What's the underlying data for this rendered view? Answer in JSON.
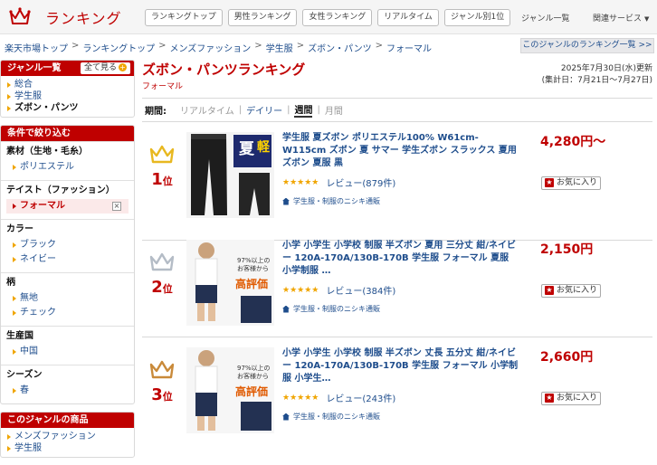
{
  "header": {
    "logo_text": "ランキング",
    "tabs": [
      "ランキングトップ",
      "男性ランキング",
      "女性ランキング",
      "リアルタイム",
      "ジャンル別1位"
    ],
    "genre_menu": "ジャンル一覧",
    "related_menu": "関連サービス"
  },
  "breadcrumb": [
    "楽天市場トップ",
    "ランキングトップ",
    "メンズファッション",
    "学生服",
    "ズボン・パンツ",
    "フォーマル"
  ],
  "genre_list_button": "このジャンルのランキング一覧 >>",
  "sidebar": {
    "genre_title": "ジャンル一覧",
    "show_all": "全て見る",
    "genres": [
      "総合",
      "学生服",
      "ズボン・パンツ"
    ],
    "filter_title": "条件で絞り込む",
    "filters": [
      {
        "title": "素材（生地・毛糸）",
        "options": [
          "ポリエステル"
        ]
      },
      {
        "title": "テイスト（ファッション）",
        "options": [
          "フォーマル"
        ],
        "selected": "フォーマル"
      },
      {
        "title": "カラー",
        "options": [
          "ブラック",
          "ネイビー"
        ]
      },
      {
        "title": "柄",
        "options": [
          "無地",
          "チェック"
        ]
      },
      {
        "title": "生産国",
        "options": [
          "中国"
        ]
      },
      {
        "title": "シーズン",
        "options": [
          "春"
        ]
      }
    ],
    "genre_products_title": "このジャンルの商品",
    "genre_products": [
      "メンズファッション",
      "学生服"
    ]
  },
  "main": {
    "title": "ズボン・パンツランキング",
    "subtitle": "フォーマル",
    "updated": "2025年7月30日(水)更新",
    "period_range": "(集計日：7月21日〜7月27日)",
    "period_label": "期間:",
    "periods": [
      "リアルタイム",
      "デイリー",
      "週間",
      "月間"
    ],
    "current_period": "週間"
  },
  "items": [
    {
      "rank": "1",
      "rank_suffix": "位",
      "title": "学生服 夏ズボン ポリエステル100% W61cm-W115cm ズボン 夏 サマー 学生ズボン スラックス 夏用ズボン 夏服 黒",
      "stars": "★★★★★",
      "reviews": "レビュー(879件)",
      "shop": "学生服・制服のニシキ通販",
      "price": "4,280円〜",
      "favorite": "お気に入り",
      "crown_color": "#e8b820"
    },
    {
      "rank": "2",
      "rank_suffix": "位",
      "title": "小学 小学生 小学校 制服 半ズボン 夏用 三分丈 紺/ネイビー 120A-170A/130B-170B 学生服 フォーマル 夏服 小学制服 …",
      "stars": "★★★★★",
      "reviews": "レビュー(384件)",
      "shop": "学生服・制服のニシキ通販",
      "price": "2,150円",
      "favorite": "お気に入り",
      "crown_color": "#b4bcc6"
    },
    {
      "rank": "3",
      "rank_suffix": "位",
      "title": "小学 小学生 小学校 制服 半ズボン 丈長 五分丈 紺/ネイビー 120A-170A/130B-170B 学生服 フォーマル 小学制服 小学生…",
      "stars": "★★★★★",
      "reviews": "レビュー(243件)",
      "shop": "学生服・制服のニシキ通販",
      "price": "2,660円",
      "favorite": "お気に入り",
      "crown_color": "#c98a3a"
    }
  ],
  "thumb_badges": {
    "summer": "夏",
    "summer_sub": "軽",
    "rating_line1": "97%以上の",
    "rating_line2": "お客様から",
    "rating_big": "高評価"
  },
  "colors": {
    "accent": "#bf0000",
    "link": "#1e4d8c",
    "star": "#f0a500"
  }
}
